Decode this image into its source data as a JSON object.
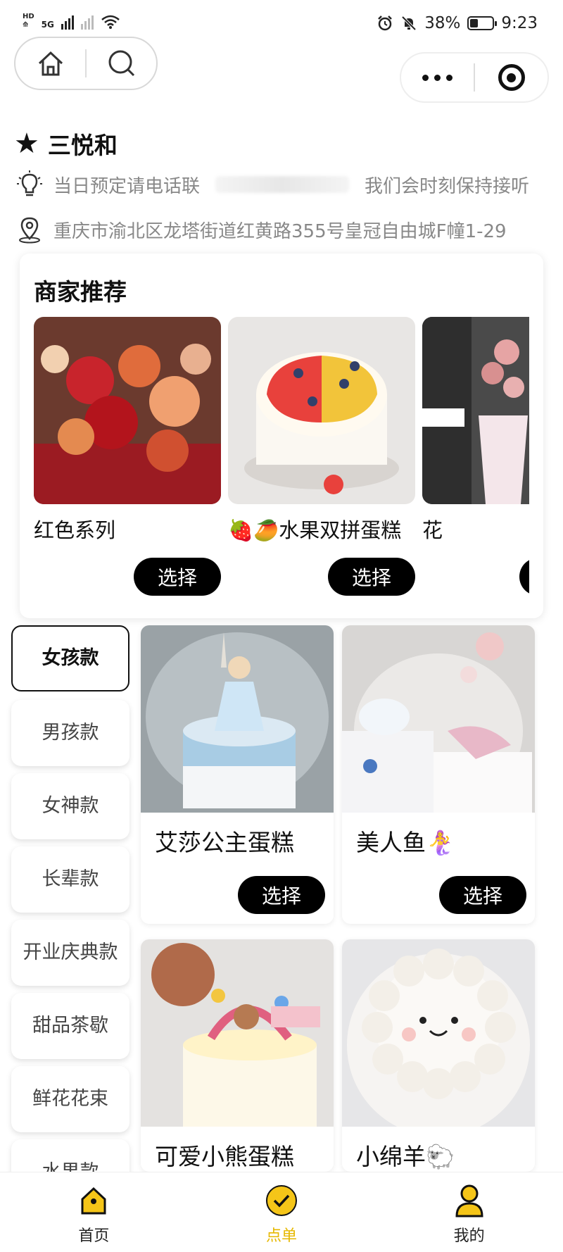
{
  "status_bar": {
    "left_top": "HD",
    "left_bottom": "⟰",
    "network": "5G",
    "battery_percent": "38%",
    "battery_level": 0.38,
    "time": "9:23"
  },
  "shop": {
    "name": "三悦和",
    "notice_prefix": "当日预定请电话联",
    "notice_suffix": "我们会时刻保持接听",
    "address": "重庆市渝北区龙塔街道红黄路355号皇冠自由城F幢1-29"
  },
  "recommend": {
    "title": "商家推荐",
    "items": [
      {
        "name": "红色系列",
        "button": "选择"
      },
      {
        "name": "🍓🥭水果双拼蛋糕",
        "button": "选择"
      },
      {
        "name": "花",
        "button": ""
      }
    ]
  },
  "categories": [
    "女孩款",
    "男孩款",
    "女神款",
    "长辈款",
    "开业庆典款",
    "甜品茶歇",
    "鲜花花束",
    "水果款"
  ],
  "products": [
    {
      "name": "艾莎公主蛋糕",
      "button": "选择"
    },
    {
      "name": "美人鱼🧜‍♀️",
      "button": "选择"
    },
    {
      "name": "可爱小熊蛋糕",
      "button": ""
    },
    {
      "name": "小绵羊🐑",
      "button": ""
    }
  ],
  "tabbar": [
    {
      "label": "首页",
      "icon": "home-icon"
    },
    {
      "label": "点单",
      "icon": "check-circle-icon"
    },
    {
      "label": "我的",
      "icon": "user-icon"
    }
  ],
  "colors": {
    "accent": "#f5c518",
    "active_tab_text": "#e6b800",
    "pill_bg": "#000000"
  }
}
